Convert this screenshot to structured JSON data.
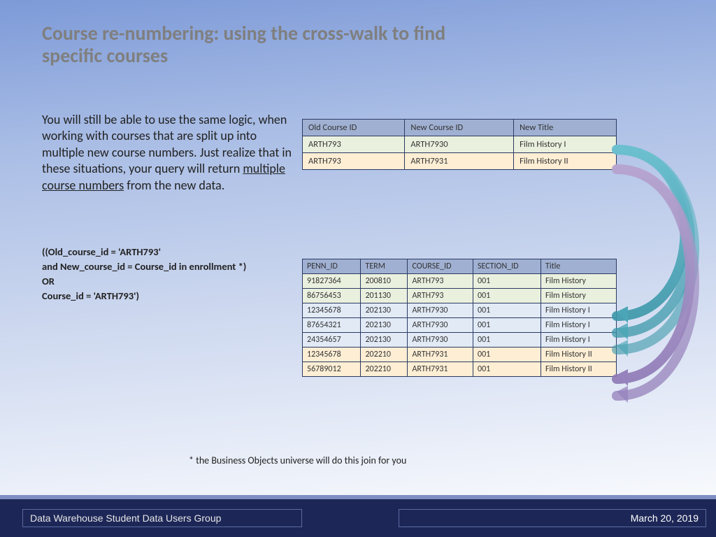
{
  "title": "Course re-numbering: using the cross-walk to find specific courses",
  "body": {
    "p1": "You will still be able to use the same logic, when working with courses that are split up into multiple new course numbers.  Just realize that in these situations, your query will return ",
    "p1_u": "multiple course numbers",
    "p1_tail": " from the new data."
  },
  "code": {
    "l1": "((Old_course_id = 'ARTH793'",
    "l2": "and New_course_id = Course_id in enrollment *)",
    "l3": "OR",
    "l4": "Course_id = 'ARTH793')"
  },
  "footnote": "* the Business Objects universe will do this join for you",
  "xwalk": {
    "headers": [
      "Old Course ID",
      "New Course ID",
      "New Title"
    ],
    "rows": [
      {
        "cls": "r-green",
        "cells": [
          "ARTH793",
          "ARTH7930",
          "Film History I"
        ]
      },
      {
        "cls": "r-cream",
        "cells": [
          "ARTH793",
          "ARTH7931",
          "Film History II"
        ]
      }
    ]
  },
  "enroll": {
    "headers": [
      "PENN_ID",
      "TERM",
      "COURSE_ID",
      "SECTION_ID",
      "Title"
    ],
    "rows": [
      {
        "cls": "r-green",
        "cells": [
          "91827364",
          "200810",
          "ARTH793",
          "001",
          "Film History"
        ]
      },
      {
        "cls": "r-green",
        "cells": [
          "86756453",
          "201130",
          "ARTH793",
          "001",
          "Film History"
        ]
      },
      {
        "cls": "r-blue",
        "cells": [
          "12345678",
          "202130",
          "ARTH7930",
          "001",
          "Film History I"
        ]
      },
      {
        "cls": "r-blue",
        "cells": [
          "87654321",
          "202130",
          "ARTH7930",
          "001",
          "Film History I"
        ]
      },
      {
        "cls": "r-blue",
        "cells": [
          "24354657",
          "202130",
          "ARTH7930",
          "001",
          "Film History I"
        ]
      },
      {
        "cls": "r-cream",
        "cells": [
          "12345678",
          "202210",
          "ARTH7931",
          "001",
          "Film History II"
        ]
      },
      {
        "cls": "r-cream",
        "cells": [
          "56789012",
          "202210",
          "ARTH7931",
          "001",
          "Film History II"
        ]
      }
    ]
  },
  "footer": {
    "left": "Data Warehouse Student Data Users Group",
    "right": "March 20, 2019"
  }
}
